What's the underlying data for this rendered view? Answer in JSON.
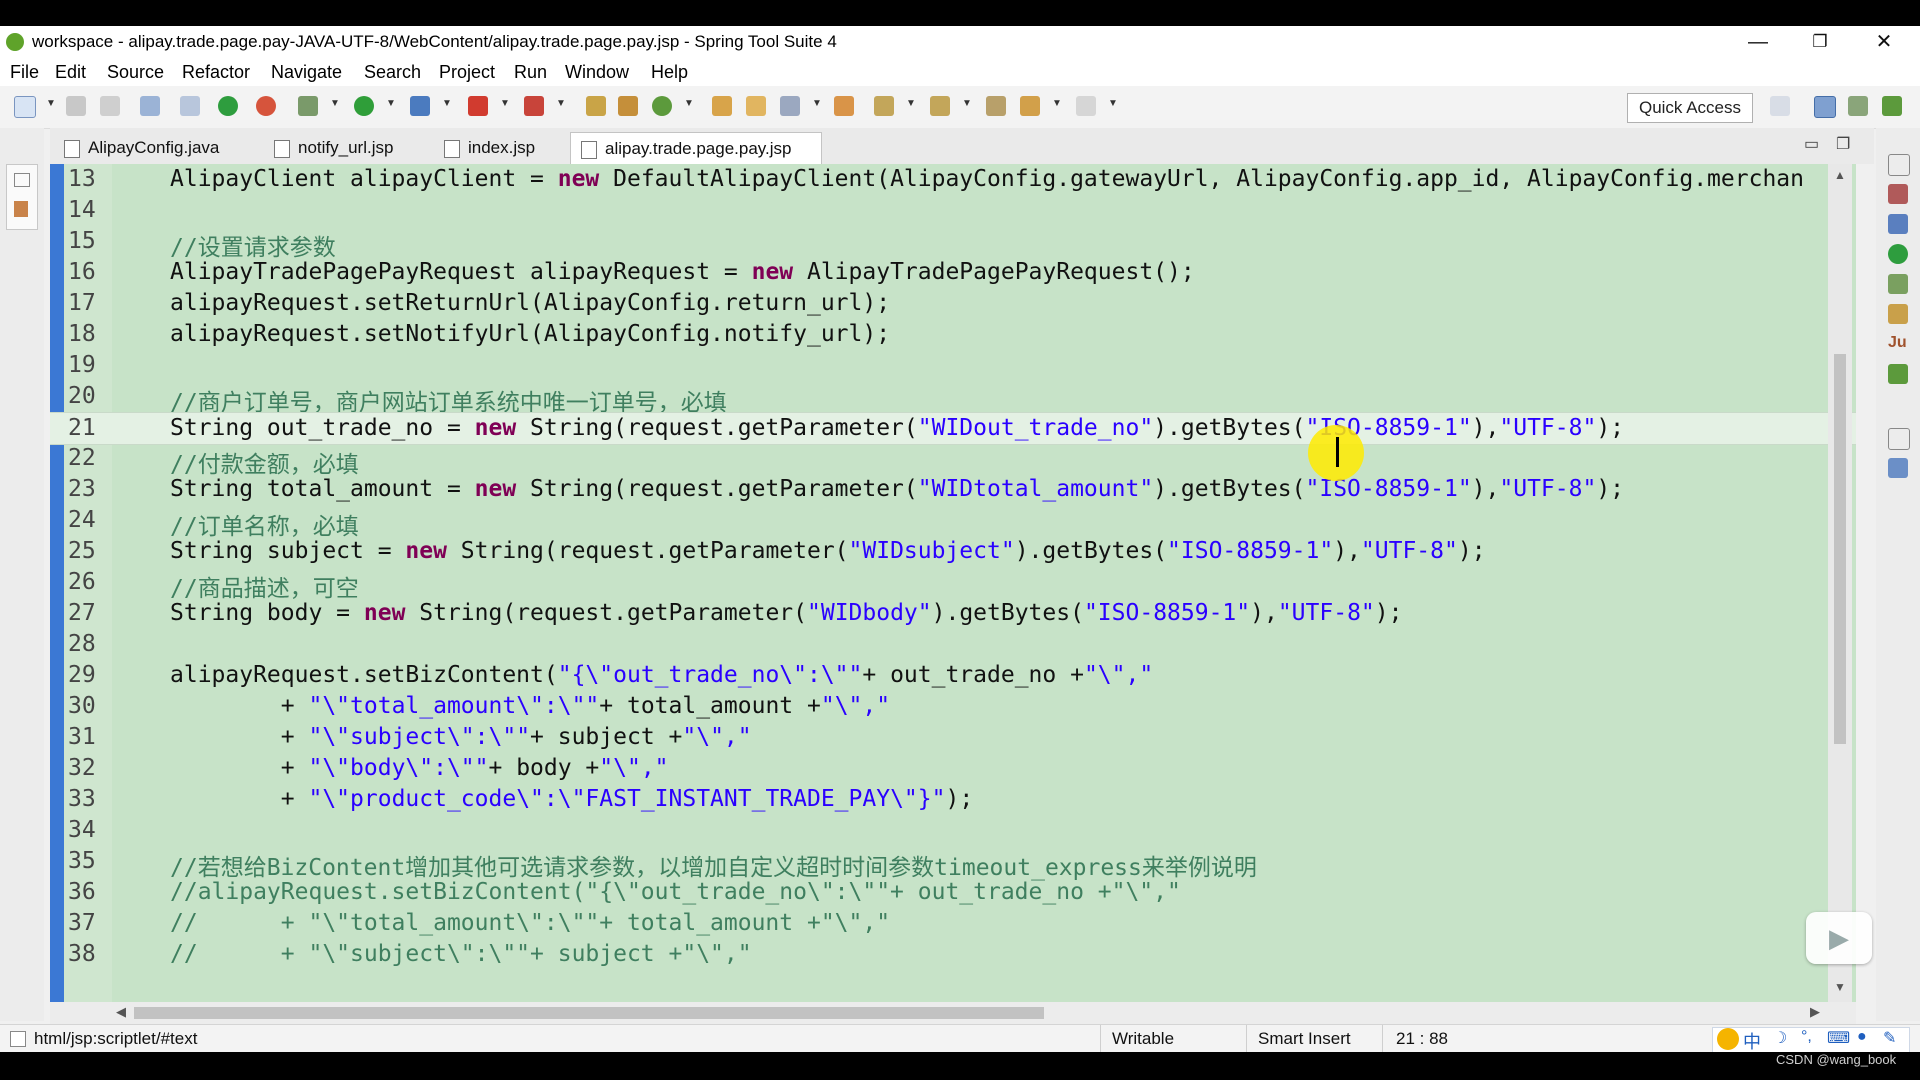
{
  "window": {
    "title": "workspace - alipay.trade.page.pay-JAVA-UTF-8/WebContent/alipay.trade.page.pay.jsp - Spring Tool Suite 4"
  },
  "menu": [
    "File",
    "Edit",
    "Source",
    "Refactor",
    "Navigate",
    "Search",
    "Project",
    "Run",
    "Window",
    "Help"
  ],
  "toolbar": {
    "quick_access": "Quick Access"
  },
  "tabs": [
    {
      "label": "AlipayConfig.java"
    },
    {
      "label": "notify_url.jsp"
    },
    {
      "label": "index.jsp"
    },
    {
      "label": "alipay.trade.page.pay.jsp",
      "close": "☒"
    }
  ],
  "editor": {
    "current_line": 21,
    "lines": [
      {
        "n": "13",
        "parts": [
          [
            "",
            "AlipayClient alipayClient = "
          ],
          [
            "kw",
            "new"
          ],
          [
            "",
            " DefaultAlipayClient(AlipayConfig.gatewayUrl, AlipayConfig.app_id, AlipayConfig.merchan"
          ]
        ]
      },
      {
        "n": "14",
        "parts": []
      },
      {
        "n": "15",
        "parts": [
          [
            "cm",
            "//设置请求参数"
          ]
        ]
      },
      {
        "n": "16",
        "parts": [
          [
            "",
            "AlipayTradePagePayRequest alipayRequest = "
          ],
          [
            "kw",
            "new"
          ],
          [
            "",
            " AlipayTradePagePayRequest();"
          ]
        ]
      },
      {
        "n": "17",
        "parts": [
          [
            "",
            "alipayRequest.setReturnUrl(AlipayConfig.return_url);"
          ]
        ]
      },
      {
        "n": "18",
        "parts": [
          [
            "",
            "alipayRequest.setNotifyUrl(AlipayConfig.notify_url);"
          ]
        ]
      },
      {
        "n": "19",
        "parts": []
      },
      {
        "n": "20",
        "parts": [
          [
            "cm",
            "//商户订单号，商户网站订单系统中唯一订单号，必填"
          ]
        ]
      },
      {
        "n": "21",
        "parts": [
          [
            "",
            "String out_trade_no = "
          ],
          [
            "kw",
            "new"
          ],
          [
            "",
            " String(request.getParameter("
          ],
          [
            "st",
            "\"WIDout_trade_no\""
          ],
          [
            "",
            ").getBytes("
          ],
          [
            "st",
            "\"ISO-8859-1\""
          ],
          [
            "",
            "),"
          ],
          [
            "st",
            "\"UTF-8\""
          ],
          [
            "",
            ");"
          ]
        ]
      },
      {
        "n": "22",
        "parts": [
          [
            "cm",
            "//付款金额，必填"
          ]
        ]
      },
      {
        "n": "23",
        "parts": [
          [
            "",
            "String total_amount = "
          ],
          [
            "kw",
            "new"
          ],
          [
            "",
            " String(request.getParameter("
          ],
          [
            "st",
            "\"WIDtotal_amount\""
          ],
          [
            "",
            ").getBytes("
          ],
          [
            "st",
            "\"ISO-8859-1\""
          ],
          [
            "",
            "),"
          ],
          [
            "st",
            "\"UTF-8\""
          ],
          [
            "",
            ");"
          ]
        ]
      },
      {
        "n": "24",
        "parts": [
          [
            "cm",
            "//订单名称，必填"
          ]
        ]
      },
      {
        "n": "25",
        "parts": [
          [
            "",
            "String subject = "
          ],
          [
            "kw",
            "new"
          ],
          [
            "",
            " String(request.getParameter("
          ],
          [
            "st",
            "\"WIDsubject\""
          ],
          [
            "",
            ").getBytes("
          ],
          [
            "st",
            "\"ISO-8859-1\""
          ],
          [
            "",
            "),"
          ],
          [
            "st",
            "\"UTF-8\""
          ],
          [
            "",
            ");"
          ]
        ]
      },
      {
        "n": "26",
        "parts": [
          [
            "cm",
            "//商品描述，可空"
          ]
        ]
      },
      {
        "n": "27",
        "parts": [
          [
            "",
            "String body = "
          ],
          [
            "kw",
            "new"
          ],
          [
            "",
            " String(request.getParameter("
          ],
          [
            "st",
            "\"WIDbody\""
          ],
          [
            "",
            ").getBytes("
          ],
          [
            "st",
            "\"ISO-8859-1\""
          ],
          [
            "",
            "),"
          ],
          [
            "st",
            "\"UTF-8\""
          ],
          [
            "",
            ");"
          ]
        ]
      },
      {
        "n": "28",
        "parts": []
      },
      {
        "n": "29",
        "parts": [
          [
            "",
            "alipayRequest.setBizContent("
          ],
          [
            "st",
            "\"{\\\"out_trade_no\\\":\\\"\""
          ],
          [
            "",
            "+ out_trade_no +"
          ],
          [
            "st",
            "\"\\\",\""
          ]
        ]
      },
      {
        "n": "30",
        "parts": [
          [
            "",
            "        + "
          ],
          [
            "st",
            "\"\\\"total_amount\\\":\\\"\""
          ],
          [
            "",
            "+ total_amount +"
          ],
          [
            "st",
            "\"\\\",\""
          ]
        ]
      },
      {
        "n": "31",
        "parts": [
          [
            "",
            "        + "
          ],
          [
            "st",
            "\"\\\"subject\\\":\\\"\""
          ],
          [
            "",
            "+ subject +"
          ],
          [
            "st",
            "\"\\\",\""
          ]
        ]
      },
      {
        "n": "32",
        "parts": [
          [
            "",
            "        + "
          ],
          [
            "st",
            "\"\\\"body\\\":\\\"\""
          ],
          [
            "",
            "+ body +"
          ],
          [
            "st",
            "\"\\\",\""
          ]
        ]
      },
      {
        "n": "33",
        "parts": [
          [
            "",
            "        + "
          ],
          [
            "st",
            "\"\\\"product_code\\\":\\\"FAST_INSTANT_TRADE_PAY\\\"}\""
          ],
          [
            "",
            ");"
          ]
        ]
      },
      {
        "n": "34",
        "parts": []
      },
      {
        "n": "35",
        "parts": [
          [
            "cm",
            "//若想给BizContent增加其他可选请求参数，以增加自定义超时时间参数timeout_express来举例说明"
          ]
        ]
      },
      {
        "n": "36",
        "parts": [
          [
            "cm",
            "//alipayRequest.setBizContent(\"{\\\"out_trade_no\\\":\\\"\"+ out_trade_no +\"\\\",\""
          ]
        ]
      },
      {
        "n": "37",
        "parts": [
          [
            "cm",
            "//      + \"\\\"total_amount\\\":\\\"\"+ total_amount +\"\\\",\""
          ]
        ]
      },
      {
        "n": "38",
        "parts": [
          [
            "cm",
            "//      + \"\\\"subject\\\":\\\"\"+ subject +\"\\\",\""
          ]
        ]
      }
    ]
  },
  "status": {
    "path": "html/jsp:scriptlet/#text",
    "writable": "Writable",
    "insert_mode": "Smart Insert",
    "position": "21 : 88"
  },
  "ime": {
    "label": "中"
  },
  "watermark": "CSDN @wang_book"
}
